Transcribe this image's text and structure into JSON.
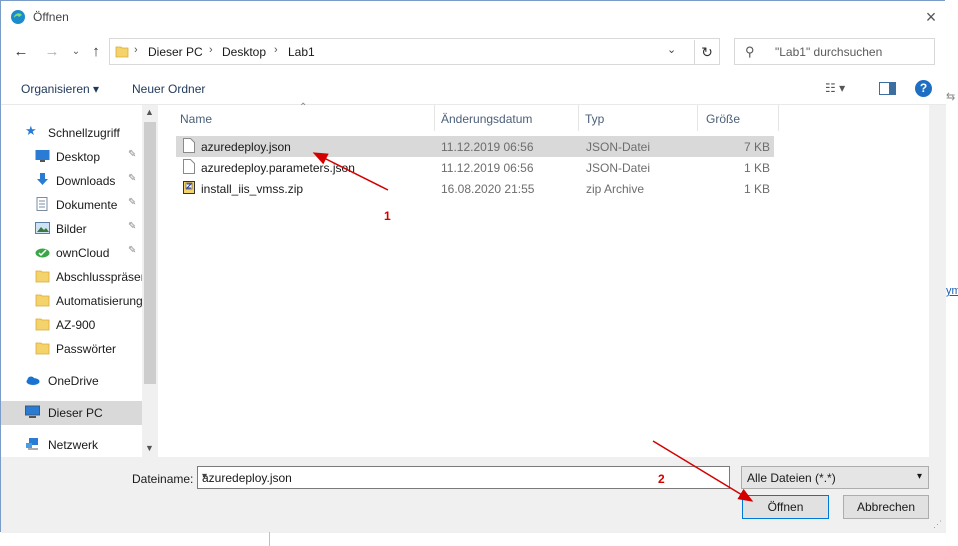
{
  "window": {
    "title": "Öffnen",
    "close_icon": "×"
  },
  "nav": {
    "back_icon": "←",
    "forward_icon": "→",
    "up_icon": "↑",
    "up_dropdown_icon": "⌄"
  },
  "address": {
    "crumbs": [
      "Dieser PC",
      "Desktop",
      "Lab1"
    ],
    "separator": "›",
    "dropdown_icon": "⌄",
    "refresh_icon": "↻"
  },
  "search": {
    "placeholder": "\"Lab1\" durchsuchen",
    "icon": "⚲"
  },
  "toolbar": {
    "organize": "Organisieren ▾",
    "new_folder": "Neuer Ordner",
    "view_icon": "☷ ▾",
    "help_icon": "?"
  },
  "sidebar": {
    "items": [
      {
        "label": "Schnellzugriff",
        "icon": "star-icon",
        "pinned": false
      },
      {
        "label": "Desktop",
        "icon": "desktop-icon",
        "pinned": true
      },
      {
        "label": "Downloads",
        "icon": "download-icon",
        "pinned": true
      },
      {
        "label": "Dokumente",
        "icon": "document-icon",
        "pinned": true
      },
      {
        "label": "Bilder",
        "icon": "pictures-icon",
        "pinned": true
      },
      {
        "label": "ownCloud",
        "icon": "owncloud-icon",
        "pinned": true
      },
      {
        "label": "Abschlusspräsentation",
        "icon": "folder-icon",
        "pinned": false
      },
      {
        "label": "Automatisierung",
        "icon": "folder-icon",
        "pinned": false
      },
      {
        "label": "AZ-900",
        "icon": "folder-icon",
        "pinned": false
      },
      {
        "label": "Passwörter",
        "icon": "folder-icon",
        "pinned": false
      },
      {
        "label": "OneDrive",
        "icon": "onedrive-icon",
        "pinned": false
      },
      {
        "label": "Dieser PC",
        "icon": "pc-icon",
        "pinned": false
      },
      {
        "label": "Netzwerk",
        "icon": "network-icon",
        "pinned": false
      }
    ],
    "pin_glyph": "📌"
  },
  "columns": {
    "name": "Name",
    "date": "Änderungsdatum",
    "type": "Typ",
    "size": "Größe"
  },
  "files": [
    {
      "name": "azuredeploy.json",
      "date": "11.12.2019 06:56",
      "type": "JSON-Datei",
      "size": "7 KB",
      "selected": true
    },
    {
      "name": "azuredeploy.parameters.json",
      "date": "11.12.2019 06:56",
      "type": "JSON-Datei",
      "size": "1 KB",
      "selected": false
    },
    {
      "name": "install_iis_vmss.zip",
      "date": "16.08.2020 21:55",
      "type": "zip Archive",
      "size": "1 KB",
      "selected": false
    }
  ],
  "footer": {
    "filename_label": "Dateiname:",
    "filename_value": "azuredeploy.json",
    "filter_value": "Alle Dateien (*.*)",
    "open_label": "Öffnen",
    "cancel_label": "Abbrechen"
  },
  "annotations": {
    "one": "1",
    "two": "2",
    "color": "#d40000"
  },
  "colors": {
    "accent": "#0078d7",
    "selected_row": "#d9d9d9"
  }
}
